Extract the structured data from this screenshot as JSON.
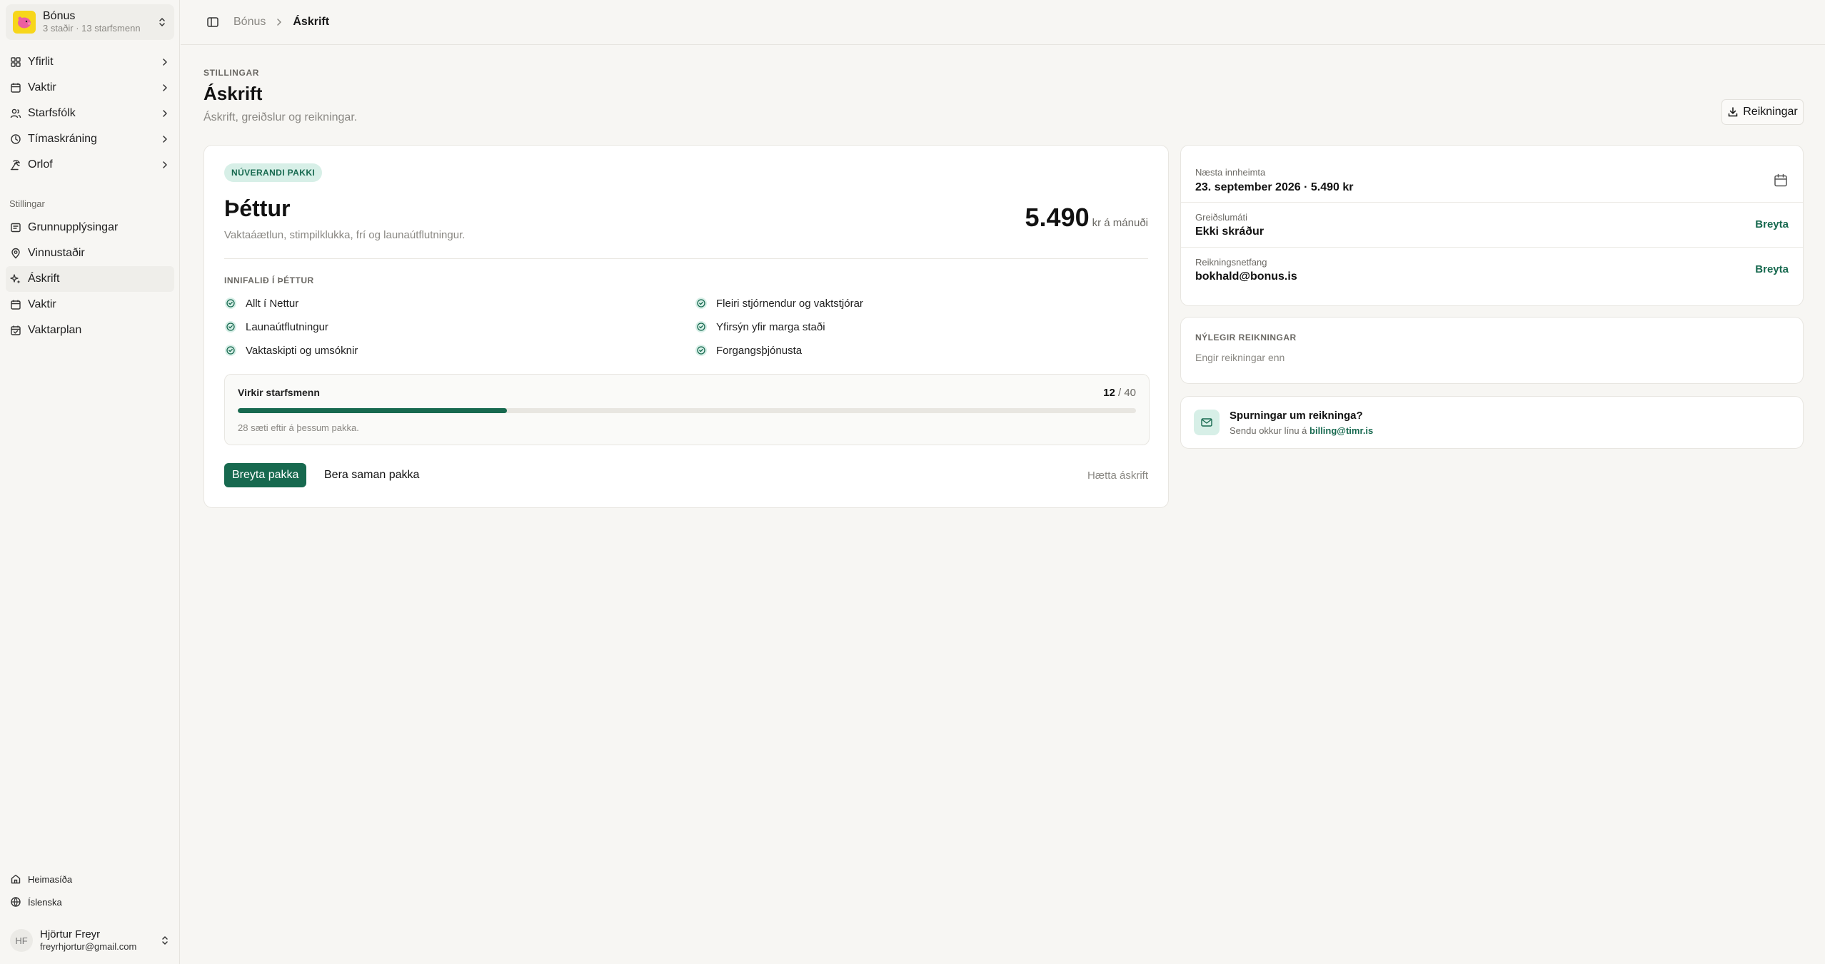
{
  "org": {
    "name": "Bónus",
    "meta": "3 staðir · 13 starfsmenn",
    "logo_color": "#f7d61a"
  },
  "nav_main": [
    {
      "label": "Yfirlit",
      "icon": "dashboard-icon"
    },
    {
      "label": "Vaktir",
      "icon": "calendar-icon"
    },
    {
      "label": "Starfsfólk",
      "icon": "users-icon"
    },
    {
      "label": "Tímaskráning",
      "icon": "clock-icon"
    },
    {
      "label": "Orlof",
      "icon": "leave-icon"
    }
  ],
  "nav_settings_label": "Stillingar",
  "nav_settings": [
    {
      "label": "Grunnupplýsingar",
      "icon": "info-icon"
    },
    {
      "label": "Vinnustaðir",
      "icon": "map-pin-icon"
    },
    {
      "label": "Áskrift",
      "icon": "sparkles-icon",
      "active": true
    },
    {
      "label": "Vaktir",
      "icon": "calendar-icon"
    },
    {
      "label": "Vaktarplan",
      "icon": "calendar-check-icon"
    }
  ],
  "bottom": {
    "home": "Heimasíða",
    "language": "Íslenska"
  },
  "user": {
    "initials": "HF",
    "name": "Hjörtur Freyr",
    "email": "freyrhjortur@gmail.com"
  },
  "breadcrumb": {
    "root": "Bónus",
    "current": "Áskrift"
  },
  "page": {
    "eyebrow": "STILLINGAR",
    "title": "Áskrift",
    "subtitle": "Áskrift, greiðslur og reikningar.",
    "invoices_button": "Reikningar"
  },
  "plan": {
    "badge": "NÚVERANDI PAKKI",
    "name": "Þéttur",
    "description": "Vaktaáætlun, stimpilklukka, frí og launaútflutningur.",
    "price": "5.490",
    "price_unit": "kr á mánuði",
    "included_label": "INNIFALIÐ Í ÞÉTTUR",
    "features": [
      "Allt í Nettur",
      "Fleiri stjórnendur og vaktstjórar",
      "Launaútflutningur",
      "Yfirsýn yfir marga staði",
      "Vaktaskipti og umsóknir",
      "Forgangsþjónusta"
    ],
    "seats": {
      "label": "Virkir starfsmenn",
      "used": "12",
      "separator": " / ",
      "total": "40",
      "fraction": 0.3,
      "note": "28 sæti eftir á þessum pakka."
    },
    "change_button": "Breyta pakka",
    "compare_button": "Bera saman pakka",
    "cancel_button": "Hætta áskrift"
  },
  "billing": {
    "next_label": "Næsta innheimta",
    "next_value": "23. september 2026 · 5.490 kr",
    "payment_label": "Greiðslumáti",
    "payment_value": "Ekki skráður",
    "payment_action": "Breyta",
    "email_label": "Reikningsnetfang",
    "email_value": "bokhald@bonus.is",
    "email_action": "Breyta"
  },
  "recent": {
    "title": "NÝLEGIR REIKNINGAR",
    "empty": "Engir reikningar enn"
  },
  "help": {
    "title": "Spurningar um reikninga?",
    "text": "Sendu okkur línu á ",
    "email": "billing@timr.is"
  },
  "colors": {
    "accent": "#17694f",
    "accent_soft": "#d7efe7",
    "background": "#f7f6f3"
  }
}
